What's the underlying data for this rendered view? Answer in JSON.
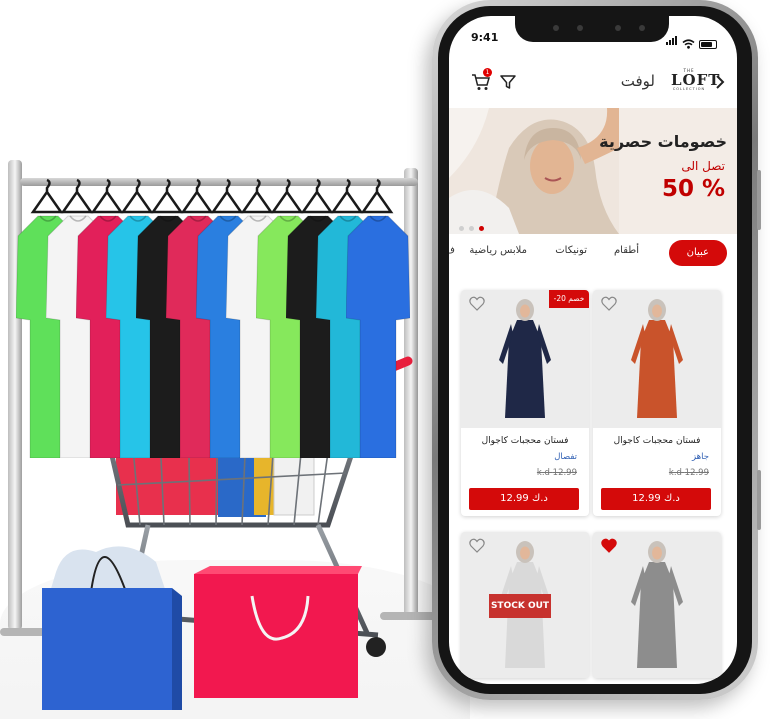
{
  "status_bar": {
    "time": "9:41"
  },
  "header": {
    "brand_ar": "لوفت",
    "logo_top": "THE",
    "logo": "LOFT",
    "logo_sub": "COLLECTION",
    "cart_count": "1"
  },
  "banner": {
    "title": "خصومات حصرية",
    "subtitle": "تصل الى",
    "percent": "50 %",
    "slide_count": 3,
    "active_slide": 3
  },
  "tabs": [
    {
      "label": "عبيان",
      "active": true
    },
    {
      "label": "أطقام",
      "active": false
    },
    {
      "label": "تونيكات",
      "active": false
    },
    {
      "label": "ملابس رياضية",
      "active": false
    },
    {
      "label": "ف",
      "active": false
    }
  ],
  "products": [
    {
      "title": "فستان محجبات كاجوال",
      "status": "جاهز",
      "old_price": "12.99 k.d",
      "price": "12.99 د.ك",
      "favorite": false,
      "discount": "",
      "dress_color": "#c9532b"
    },
    {
      "title": "فستان محجبات كاجوال",
      "status": "تفصال",
      "old_price": "12.99 k.d",
      "price": "12.99 د.ك",
      "favorite": false,
      "discount": "خصم 20-",
      "dress_color": "#1f2847"
    },
    {
      "title": "",
      "status": "",
      "old_price": "",
      "price": "",
      "favorite": true,
      "discount": "",
      "dress_color": "#8d8d8d"
    },
    {
      "title": "",
      "status": "",
      "old_price": "",
      "price": "",
      "favorite": false,
      "discount": "",
      "dress_color": "#d9d9d9",
      "stock_label": "STOCK OUT"
    }
  ],
  "colors": {
    "accent": "#d40a0a",
    "link_blue": "#2f5fb3"
  }
}
